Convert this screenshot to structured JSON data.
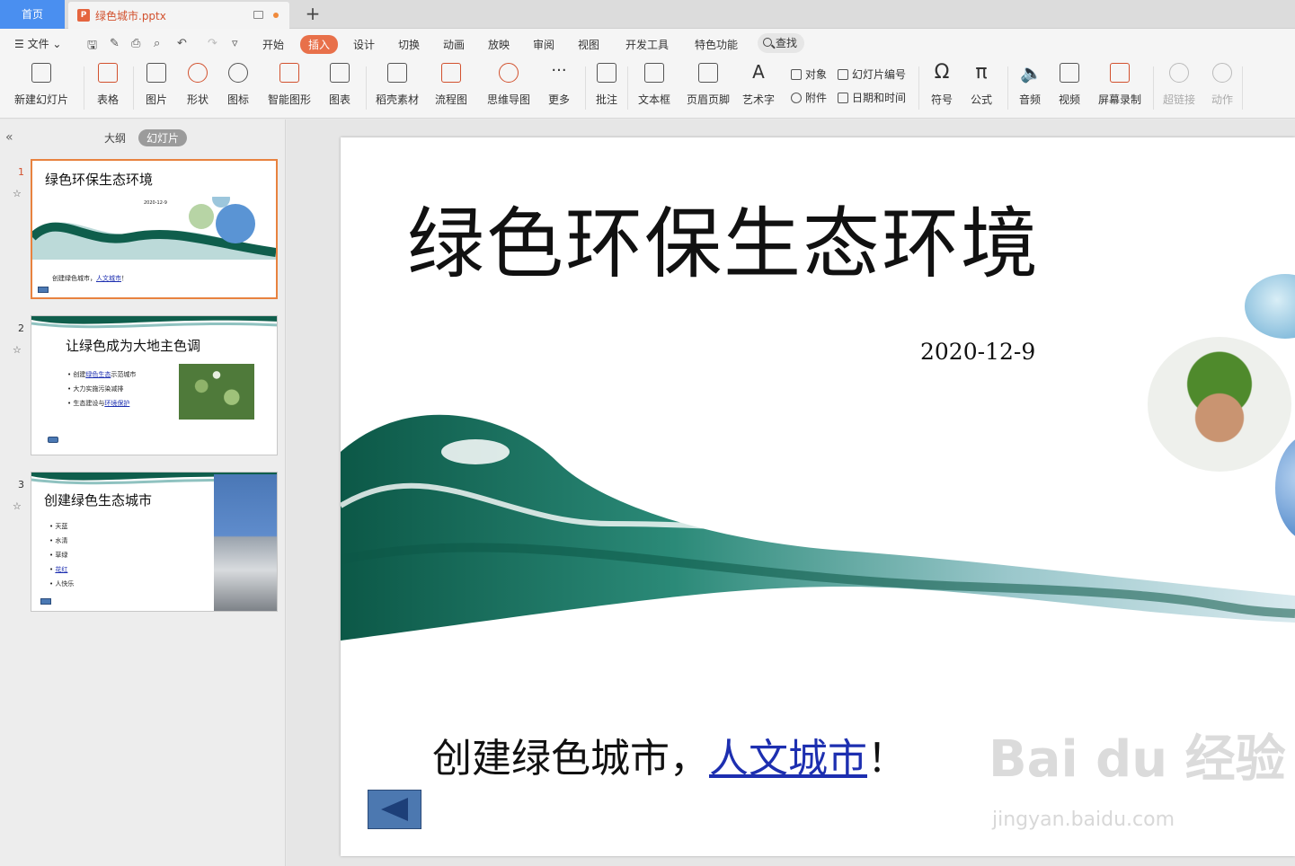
{
  "tabs": {
    "home": "首页",
    "document": "绿色城市.pptx",
    "add": "+"
  },
  "menu": {
    "file": "文件",
    "items": [
      "开始",
      "插入",
      "设计",
      "切换",
      "动画",
      "放映",
      "审阅",
      "视图",
      "开发工具",
      "特色功能"
    ],
    "active": "插入",
    "search": "查找"
  },
  "ribbon": {
    "new_slide": "新建幻灯片",
    "table": "表格",
    "picture": "图片",
    "shape": "形状",
    "icon": "图标",
    "smart_art": "智能图形",
    "chart": "图表",
    "material": "稻壳素材",
    "flowchart": "流程图",
    "mindmap": "思维导图",
    "more": "更多",
    "comment": "批注",
    "textbox": "文本框",
    "header_footer": "页眉页脚",
    "wordart": "艺术字",
    "object": "对象",
    "attachment": "附件",
    "slide_number": "幻灯片编号",
    "date_time": "日期和时间",
    "symbol": "符号",
    "formula": "公式",
    "audio": "音频",
    "video": "视频",
    "screen_record": "屏幕录制",
    "hyperlink": "超链接",
    "action": "动作"
  },
  "panel": {
    "outline": "大纲",
    "slides": "幻灯片",
    "collapse": "«"
  },
  "thumbnails": [
    {
      "num": "1",
      "title": "绿色环保生态环境",
      "date": "2020-12-9",
      "sub_text": "创建绿色城市，",
      "sub_link": "人文城市",
      "sub_end": "！"
    },
    {
      "num": "2",
      "title": "让绿色成为大地主色调",
      "bullets": [
        {
          "pre": "创建",
          "link": "绿色生态",
          "post": "示范城市"
        },
        {
          "pre": "大力实施污染减排",
          "link": "",
          "post": ""
        },
        {
          "pre": "生态建设与",
          "link": "环境保护",
          "post": ""
        }
      ]
    },
    {
      "num": "3",
      "title": "创建绿色生态城市",
      "bullets": [
        "天蓝",
        "水清",
        "草绿",
        "花红",
        "人快乐"
      ],
      "link_index": 3
    }
  ],
  "slide": {
    "title": "绿色环保生态环境",
    "date": "2020-12-9",
    "sub_text": "创建绿色城市，",
    "sub_link": "人文城市",
    "sub_end": "！"
  },
  "watermark": {
    "main": "Bai du 经验",
    "sub": "jingyan.baidu.com"
  },
  "colors": {
    "accent": "#e8704a",
    "home_tab": "#4a8ff0",
    "link": "#1d2fb0",
    "wave_dark": "#0f5e4c",
    "wave_light": "#8fc2c0"
  }
}
